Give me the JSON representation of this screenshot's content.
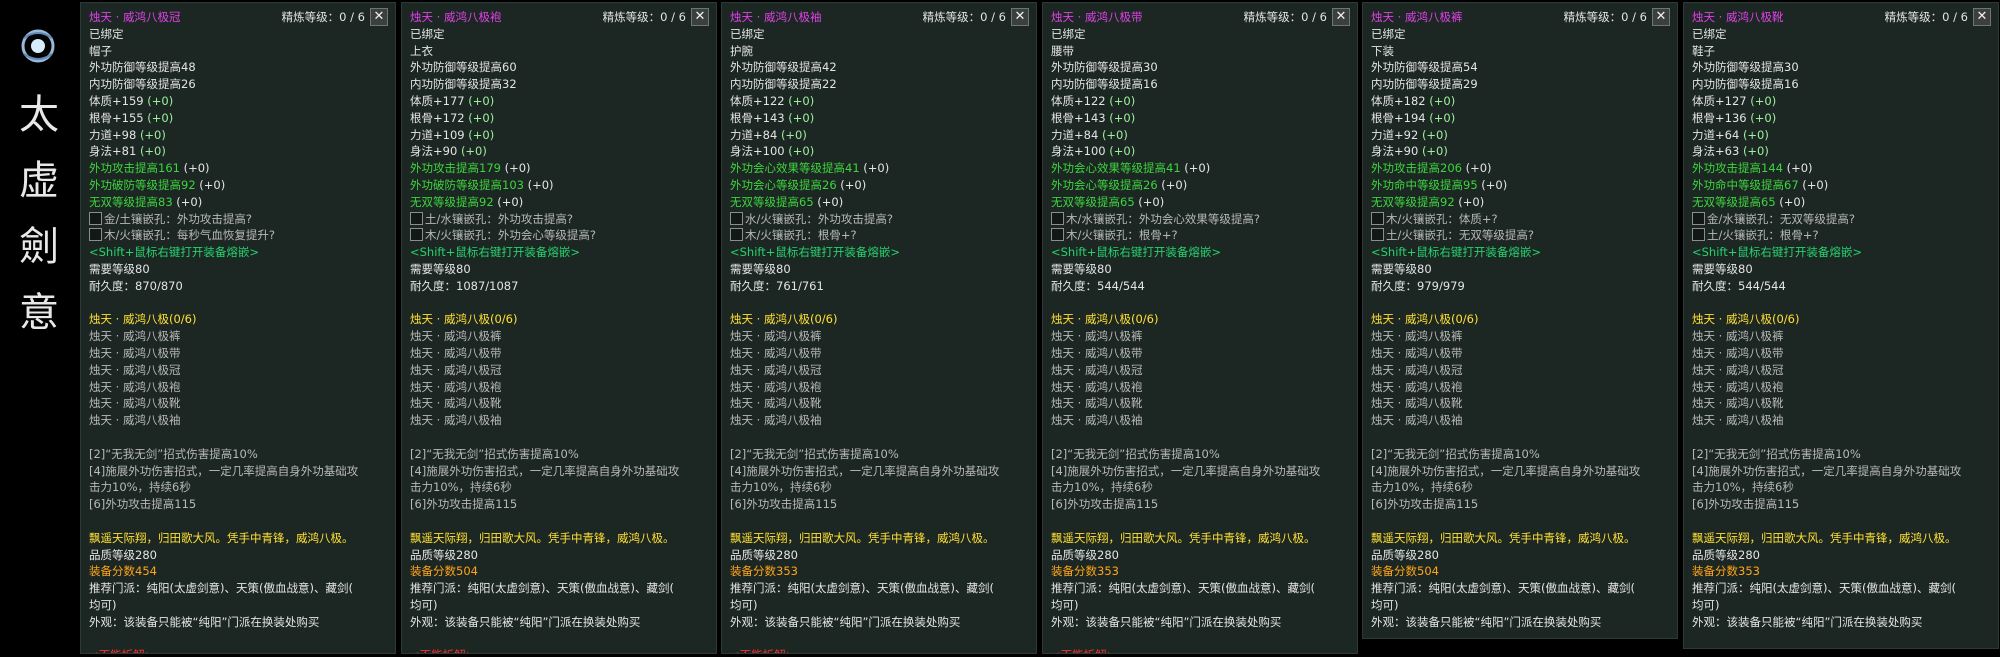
{
  "sect": {
    "chars": [
      "太",
      "虚",
      "劍",
      "意"
    ]
  },
  "panels": [
    {
      "name": "烛天 · 威鸿八极冠",
      "refine": "精炼等级：0 / 6",
      "slot": "帽子",
      "outer_def": "外功防御等级提高48",
      "inner_def": "内功防御等级提高26",
      "s1_label": "体质+159",
      "s2_label": "根骨+155",
      "s3_label": "力道+98",
      "s4_label": "身法+81",
      "g1": "外功攻击提高161",
      "g2": "外功破防等级提高92",
      "g3": "无双等级提高83",
      "sock1": "金/土镶嵌孔：外功攻击提高?",
      "sock2": "木/火镶嵌孔：每秒气血恢复提升?",
      "durability": "耐久度：870/870",
      "score": "装备分数454"
    },
    {
      "name": "烛天 · 威鸿八极袍",
      "refine": "精炼等级：0 / 6",
      "slot": "上衣",
      "outer_def": "外功防御等级提高60",
      "inner_def": "内功防御等级提高32",
      "s1_label": "体质+177",
      "s2_label": "根骨+172",
      "s3_label": "力道+109",
      "s4_label": "身法+90",
      "g1": "外功攻击提高179",
      "g2": "外功破防等级提高103",
      "g3": "无双等级提高92",
      "sock1": "土/水镶嵌孔：外功攻击提高?",
      "sock2": "木/火镶嵌孔：外功会心等级提高?",
      "durability": "耐久度：1087/1087",
      "score": "装备分数504"
    },
    {
      "name": "烛天 · 威鸿八极袖",
      "refine": "精炼等级：0 / 6",
      "slot": "护腕",
      "outer_def": "外功防御等级提高42",
      "inner_def": "内功防御等级提高22",
      "s1_label": "体质+122",
      "s2_label": "根骨+143",
      "s3_label": "力道+84",
      "s4_label": "身法+100",
      "g1": "外功会心效果等级提高41",
      "g2": "外功会心等级提高26",
      "g3": "无双等级提高65",
      "sock1": "水/火镶嵌孔：外功攻击提高?",
      "sock2": "木/火镶嵌孔：根骨+?",
      "durability": "耐久度：761/761",
      "score": "装备分数353"
    },
    {
      "name": "烛天 · 威鸿八极带",
      "refine": "精炼等级：0 / 6",
      "slot": "腰带",
      "outer_def": "外功防御等级提高30",
      "inner_def": "内功防御等级提高16",
      "s1_label": "体质+122",
      "s2_label": "根骨+143",
      "s3_label": "力道+84",
      "s4_label": "身法+100",
      "g1": "外功会心效果等级提高41",
      "g2": "外功会心等级提高26",
      "g3": "无双等级提高65",
      "sock1": "木/水镶嵌孔：外功会心效果等级提高?",
      "sock2": "木/火镶嵌孔：根骨+?",
      "durability": "耐久度：544/544",
      "score": "装备分数353"
    },
    {
      "name": "烛天 · 威鸿八极裤",
      "refine": "精炼等级：0 / 6",
      "slot": "下装",
      "outer_def": "外功防御等级提高54",
      "inner_def": "内功防御等级提高29",
      "s1_label": "体质+182",
      "s2_label": "根骨+194",
      "s3_label": "力道+92",
      "s4_label": "身法+90",
      "g1": "外功攻击提高206",
      "g2": "外功命中等级提高95",
      "g3": "无双等级提高92",
      "sock1": "木/火镶嵌孔：体质+?",
      "sock2": "土/火镶嵌孔：无双等级提高?",
      "durability": "耐久度：979/979",
      "score": "装备分数504"
    },
    {
      "name": "烛天 · 威鸿八极靴",
      "refine": "精炼等级：0 / 6",
      "slot": "鞋子",
      "outer_def": "外功防御等级提高30",
      "inner_def": "内功防御等级提高16",
      "s1_label": "体质+127",
      "s2_label": "根骨+136",
      "s3_label": "力道+64",
      "s4_label": "身法+63",
      "g1": "外功攻击提高144",
      "g2": "外功命中等级提高67",
      "g3": "无双等级提高65",
      "sock1": "金/水镶嵌孔：无双等级提高?",
      "sock2": "土/火镶嵌孔：根骨+?",
      "durability": "耐久度：544/544",
      "score": "装备分数353"
    }
  ],
  "common": {
    "bound": "已绑定",
    "plus0": "(+0)",
    "shift_hint": "<Shift+鼠标右键打开装备熔嵌>",
    "req_level": "需要等级80",
    "set_title": "烛天 · 威鸿八极(0/6)",
    "set_items": [
      "烛天 · 威鸿八极裤",
      "烛天 · 威鸿八极带",
      "烛天 · 威鸿八极冠",
      "烛天 · 威鸿八极袍",
      "烛天 · 威鸿八极靴",
      "烛天 · 威鸿八极袖"
    ],
    "bonus2": "[2]“无我无剑”招式伤害提高10%",
    "bonus4a": "[4]施展外功伤害招式，一定几率提高自身外功基础攻",
    "bonus4b": "击力10%，持续6秒",
    "bonus6": "[6]外功攻击提高115",
    "flavor": "飘遥天际翔，归田歌大风。凭手中青锋，威鸿八极。",
    "quality": "品质等级280",
    "recommend_a": "推荐门派：纯阳(太虚剑意)、天策(傲血战意)、藏剑(",
    "recommend_b": "均可)",
    "appearance": "外观：该装备只能被“纯阳”门派在换装处购买",
    "no_dismantle": "<不能拆解>",
    "close": "✕"
  },
  "colors": {
    "name": "#e040e8",
    "green": "#3ed43e",
    "set_yellow": "#ffe033",
    "score_gold": "#ffa418",
    "red": "#ff3030",
    "panel_bg": "#1c2723"
  }
}
